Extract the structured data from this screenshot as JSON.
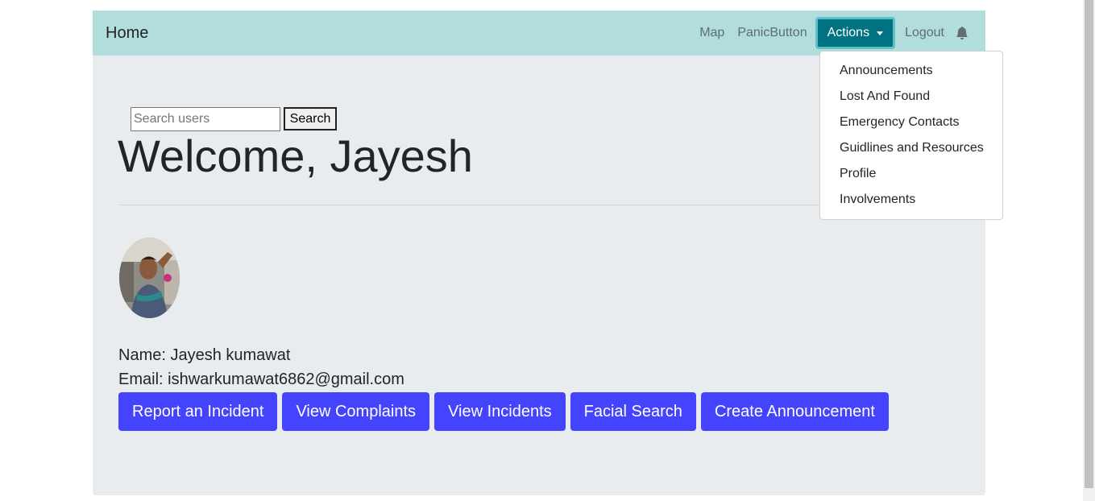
{
  "navbar": {
    "brand": "Home",
    "links": [
      "Map",
      "PanicButton"
    ],
    "actions_label": "Actions",
    "logout_label": "Logout",
    "bell_icon": "bell-icon"
  },
  "actions_menu": {
    "items": [
      "Announcements",
      "Lost And Found",
      "Emergency Contacts",
      "Guidlines and Resources",
      "Profile",
      "Involvements"
    ]
  },
  "search": {
    "placeholder": "Search users",
    "value": "",
    "button_label": "Search"
  },
  "welcome": {
    "heading": "Welcome, Jayesh"
  },
  "profile": {
    "name_line": "Name: Jayesh kumawat",
    "email_line": "Email: ishwarkumawat6862@gmail.com"
  },
  "buttons": [
    "Report an Incident",
    "View Complaints",
    "View Incidents",
    "Facial Search",
    "Create Announcement"
  ],
  "colors": {
    "navbar_bg": "#b1dddc",
    "actions_bg": "#007382",
    "button_bg": "#4444ff",
    "main_bg": "#e9ecef"
  }
}
